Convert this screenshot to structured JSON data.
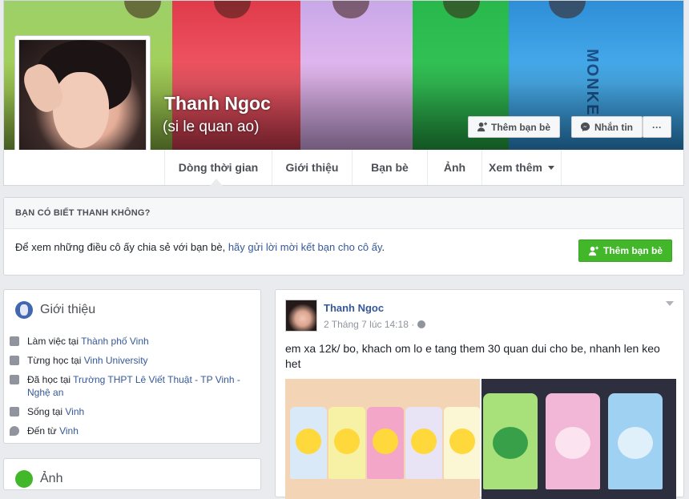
{
  "profile": {
    "name": "Thanh Ngoc",
    "alternate_name": "(si le quan ao)",
    "cover_text": "MONKE"
  },
  "actions": {
    "add_friend": "Thêm bạn bè",
    "message": "Nhắn tin",
    "more": "···"
  },
  "tabs": [
    "Dòng thời gian",
    "Giới thiệu",
    "Bạn bè",
    "Ảnh",
    "Xem thêm"
  ],
  "know": {
    "header": "BẠN CÓ BIẾT THANH KHÔNG?",
    "text_before": "Để xem những điều cô ấy chia sẻ với bạn bè, ",
    "link": "hãy gửi lời mời kết bạn cho cô ấy",
    "text_after": ".",
    "button": "Thêm bạn bè"
  },
  "intro": {
    "title": "Giới thiệu",
    "rows": [
      {
        "prefix": "Làm việc tại ",
        "link": "Thành phố Vinh"
      },
      {
        "prefix": "Từng học tại ",
        "link": "Vinh University"
      },
      {
        "prefix": "Đã học tại ",
        "link": "Trường THPT Lê Viết Thuật - TP Vinh - Nghệ an"
      },
      {
        "prefix": "Sống tại ",
        "link": "Vinh"
      },
      {
        "prefix": "Đến từ ",
        "link": "Vinh"
      }
    ]
  },
  "photos": {
    "title": "Ảnh"
  },
  "post": {
    "author": "Thanh Ngoc",
    "time": "2 Tháng 7 lúc 14:18 ·",
    "text": "em xa 12k/ bo, khach om lo e tang them 30 quan dui cho be, nhanh len keo het"
  },
  "colors": {
    "link": "#365899",
    "green": "#42b72a",
    "background": "#e9ebee"
  }
}
